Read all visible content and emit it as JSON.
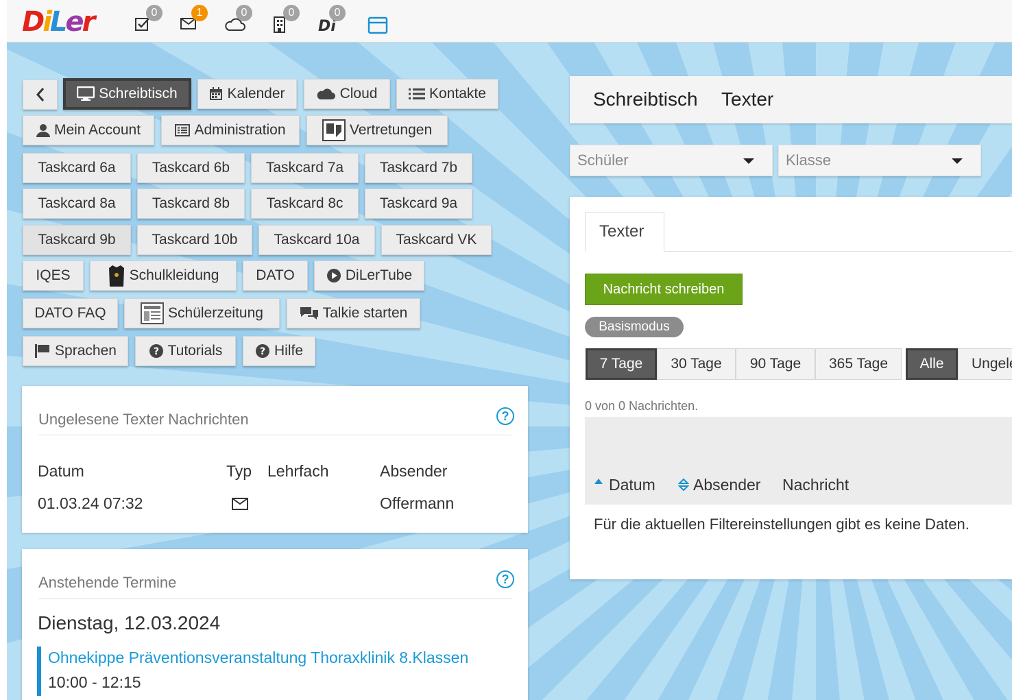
{
  "app": {
    "logo_text": "DiLer"
  },
  "topbar": {
    "icons": [
      {
        "name": "tasks-icon",
        "badge": "0"
      },
      {
        "name": "mail-icon",
        "badge": "1"
      },
      {
        "name": "cloud-icon",
        "badge": "0"
      },
      {
        "name": "building-icon",
        "badge": "0"
      },
      {
        "name": "diler-icon",
        "badge": "0"
      },
      {
        "name": "window-icon"
      }
    ]
  },
  "nav": {
    "back_label": "",
    "row1": [
      "Schreibtisch",
      "Kalender",
      "Cloud",
      "Kontakte"
    ],
    "row2": [
      "Mein Account",
      "Administration",
      "Vertretungen"
    ],
    "taskcards": [
      "Taskcard 6a",
      "Taskcard 6b",
      "Taskcard 7a",
      "Taskcard 7b",
      "Taskcard 8a",
      "Taskcard 8b",
      "Taskcard 8c",
      "Taskcard 9a",
      "Taskcard 9b",
      "Taskcard 10b",
      "Taskcard 10a",
      "Taskcard VK"
    ],
    "row6": [
      "IQES",
      "Schulkleidung",
      "DATO",
      "DiLerTube"
    ],
    "row7": [
      "DATO FAQ",
      "Schülerzeitung",
      "Talkie starten"
    ],
    "row8": [
      "Sprachen",
      "Tutorials",
      "Hilfe"
    ]
  },
  "unread": {
    "title": "Ungelesene Texter Nachrichten",
    "help": "?",
    "columns": [
      "Datum",
      "Typ",
      "Lehrfach",
      "Absender"
    ],
    "rows": [
      {
        "datum": "01.03.24 07:32",
        "typ": "mail-icon",
        "lehrfach": "",
        "absender": "Offermann"
      }
    ]
  },
  "termine": {
    "title": "Anstehende Termine",
    "help": "?",
    "date": "Dienstag, 12.03.2024",
    "event_title": "Ohnekippe Präventionsveranstaltung Thoraxklinik 8.Klassen",
    "event_time": "10:00 - 12:15"
  },
  "main": {
    "breadcrumb_1": "Schreibtisch",
    "breadcrumb_2": "Texter",
    "filter_schueler": "Schüler",
    "filter_klasse": "Klasse",
    "tab": "Texter",
    "new_message_button": "Nachricht schreiben",
    "mode_badge": "Basismodus",
    "period_filters": [
      "7 Tage",
      "30 Tage",
      "90 Tage",
      "365 Tage"
    ],
    "read_filters": [
      "Alle",
      "Ungele"
    ],
    "count_text": "0 von 0 Nachrichten.",
    "columns": [
      "Datum",
      "Absender",
      "Nachricht"
    ],
    "empty_text": "Für die aktuellen Filtereinstellungen gibt es keine Daten."
  },
  "colors": {
    "accent": "#1a9ad6",
    "primary_button": "#6ca419",
    "active_button": "#595959"
  }
}
